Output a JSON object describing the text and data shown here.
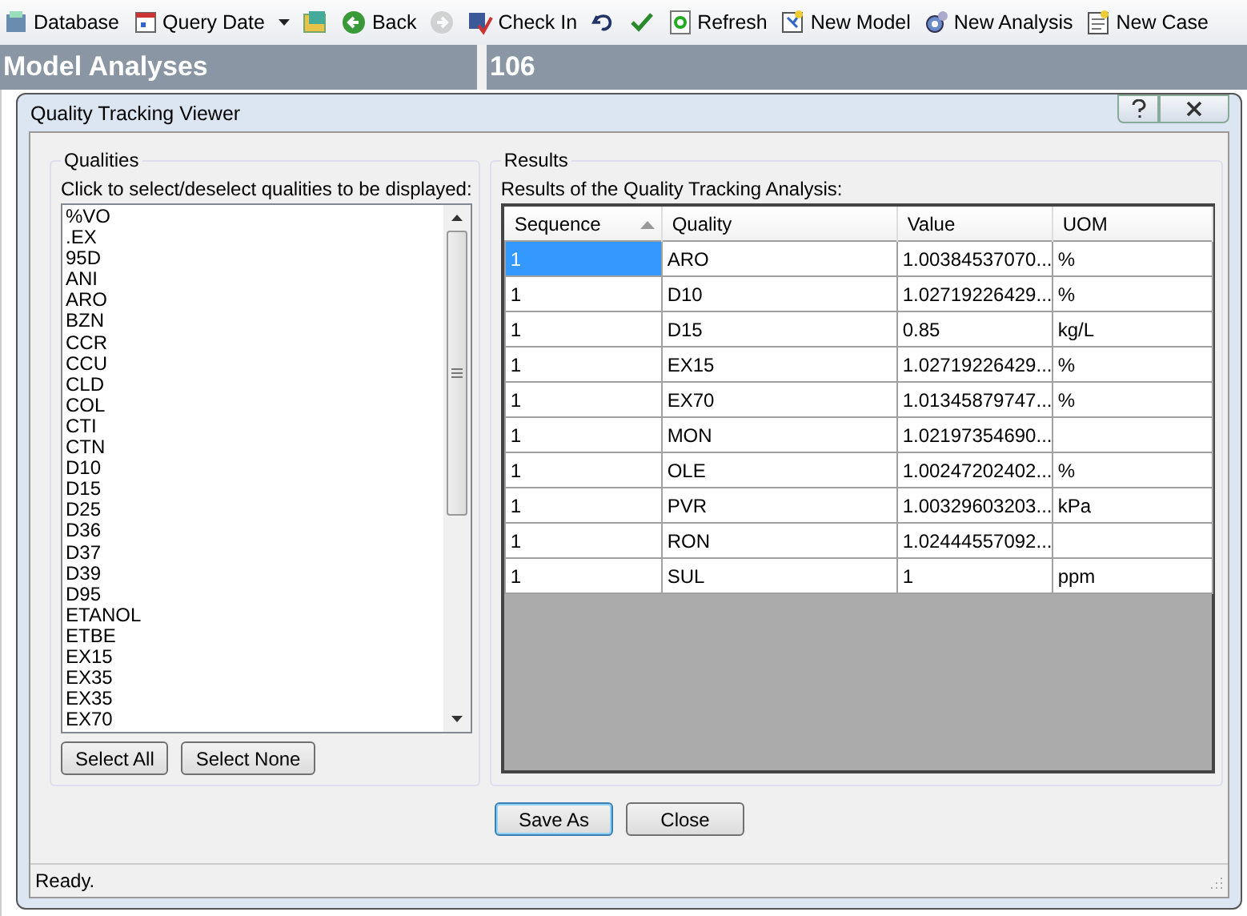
{
  "toolbar": [
    {
      "kind": "button",
      "label": "Database"
    },
    {
      "kind": "dropdown",
      "label": "Query Date"
    },
    {
      "kind": "icon"
    },
    {
      "kind": "button",
      "label": "Back"
    },
    {
      "kind": "icon",
      "disabled": true
    },
    {
      "kind": "button",
      "label": "Check In"
    },
    {
      "kind": "icon"
    },
    {
      "kind": "icon"
    },
    {
      "kind": "button",
      "label": "Refresh"
    },
    {
      "kind": "button",
      "label": "New Model"
    },
    {
      "kind": "button",
      "label": "New Analysis"
    },
    {
      "kind": "button",
      "label": "New Case"
    }
  ],
  "panes": [
    {
      "title": "Model Analyses"
    },
    {
      "title": "106"
    }
  ],
  "dialog": {
    "title": "Quality Tracking Viewer",
    "qualities": {
      "legend": "Qualities",
      "instruction": "Click to select/deselect qualities to be displayed:",
      "items": [
        "%VO",
        ".EX",
        "95D",
        "ANI",
        "ARO",
        "BZN",
        "CCR",
        "CCU",
        "CLD",
        "COL",
        "CTI",
        "CTN",
        "D10",
        "D15",
        "D25",
        "D36",
        "D37",
        "D39",
        "D95",
        "ETANOL",
        "ETBE",
        "EX15",
        "EX35",
        "EX35",
        "EX70"
      ],
      "buttons": [
        "Select All",
        "Select None"
      ]
    },
    "results": {
      "legend": "Results",
      "caption": "Results of the Quality Tracking Analysis:",
      "columns": [
        "Sequence",
        "Quality",
        "Value",
        "UOM"
      ],
      "rows": [
        {
          "cells": [
            "1",
            "ARO",
            "1.00384537070...",
            "%"
          ],
          "selected": true
        },
        {
          "cells": [
            "1",
            "D10",
            "1.02719226429...",
            "%"
          ],
          "selected": false
        },
        {
          "cells": [
            "1",
            "D15",
            "0.85",
            "kg/L"
          ],
          "selected": false
        },
        {
          "cells": [
            "1",
            "EX15",
            "1.02719226429...",
            "%"
          ],
          "selected": false
        },
        {
          "cells": [
            "1",
            "EX70",
            "1.01345879747...",
            "%"
          ],
          "selected": false
        },
        {
          "cells": [
            "1",
            "MON",
            "1.02197354690...",
            ""
          ],
          "selected": false
        },
        {
          "cells": [
            "1",
            "OLE",
            "1.00247202402...",
            "%"
          ],
          "selected": false
        },
        {
          "cells": [
            "1",
            "PVR",
            "1.00329603203...",
            "kPa"
          ],
          "selected": false
        },
        {
          "cells": [
            "1",
            "RON",
            "1.02444557092...",
            ""
          ],
          "selected": false
        },
        {
          "cells": [
            "1",
            "SUL",
            "1",
            "ppm"
          ],
          "selected": false
        }
      ]
    },
    "buttons": [
      {
        "label": "Save As",
        "default": true
      },
      {
        "label": "Close",
        "default": false
      }
    ],
    "status": "Ready."
  }
}
